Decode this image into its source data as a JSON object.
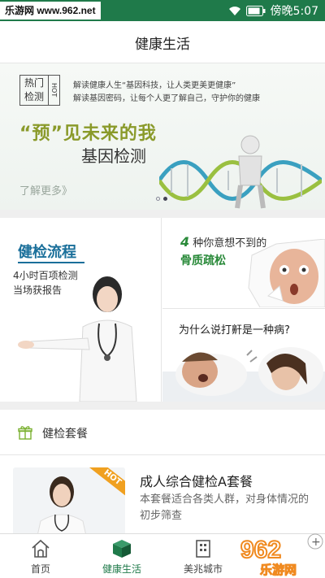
{
  "status_bar": {
    "watermark": "乐游网 www.962.net",
    "time": "傍晚5:07",
    "wifi_icon": "wifi-icon",
    "battery_icon": "battery-icon"
  },
  "header": {
    "title": "健康生活"
  },
  "banner": {
    "stamp_text": "热门检测",
    "stamp_hot": "HOT",
    "line1": "解读健康人生“基因科技，让人类更美更健康”",
    "line2": "解读基因密码，让每个人更了解自己，守护你的健康",
    "slogan": "“预”见未来的我",
    "subtitle": "基因检测",
    "more_link": "了解更多》",
    "page_count": 2,
    "active_page": 2
  },
  "features": {
    "left": {
      "title": "健检流程",
      "sub1": "4小时百项检测",
      "sub2": "当场获报告"
    },
    "right_top": {
      "num": "4",
      "title": "种你意想不到的",
      "subtitle": "骨质疏松"
    },
    "right_bottom": {
      "title": "为什么说打鼾是一种病?"
    }
  },
  "packages": {
    "section_title": "健检套餐",
    "gift_icon": "gift-icon",
    "item": {
      "badge": "HOT",
      "name": "成人综合健检A套餐",
      "desc": "本套餐适合各类人群，对身体情况的初步筛查"
    }
  },
  "bottom_nav": {
    "items": [
      {
        "label": "首页",
        "icon": "home-icon"
      },
      {
        "label": "健康生活",
        "icon": "cube-icon",
        "active": true
      },
      {
        "label": "美兆城市",
        "icon": "building-icon"
      }
    ]
  },
  "watermark_badge": {
    "brand": "962",
    "sub": "乐游网"
  },
  "colors": {
    "primary": "#1f7a4a",
    "accent_blue": "#1a6f9a",
    "green_text": "#2a8a3a",
    "hot": "#f0a020"
  }
}
